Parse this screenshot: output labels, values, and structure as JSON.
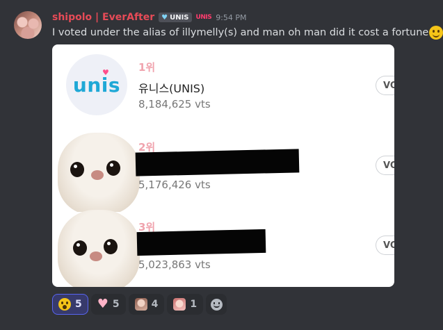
{
  "message": {
    "username": "shipolo | EverAfter",
    "server_tag": "UNIS",
    "role_icon_text": "UNIS",
    "timestamp": "9:54 PM",
    "text": "I voted under the alias of illymelly(s) and man oh man did it cost a fortune",
    "emoji": "slightly-smiling-tear-icon"
  },
  "embed": {
    "rows": [
      {
        "rank": "1위",
        "name": "유니스(UNIS)",
        "votes": "8,184,625 vts",
        "button": "VO",
        "image": "unis-logo",
        "logo_text": "unis"
      },
      {
        "rank": "2위",
        "name": "",
        "votes": "5,176,426 vts",
        "button": "VO",
        "image": "dog-photo"
      },
      {
        "rank": "3위",
        "name": "",
        "votes": "5,023,863 vts",
        "button": "VO",
        "image": "dog-photo"
      }
    ]
  },
  "reactions": [
    {
      "emoji": "surprised-face-icon",
      "count": "5",
      "active": true
    },
    {
      "emoji": "pink-heart-icon",
      "count": "5",
      "active": false
    },
    {
      "emoji": "custom-photo-emoji-icon",
      "count": "4",
      "active": false
    },
    {
      "emoji": "custom-photo-emoji-icon",
      "count": "1",
      "active": false
    }
  ],
  "colors": {
    "background": "#313338",
    "username": "#e64b57",
    "reaction_active": "#5865f2",
    "rank": "#f0a3ad",
    "logo": "#1fa8d6"
  }
}
